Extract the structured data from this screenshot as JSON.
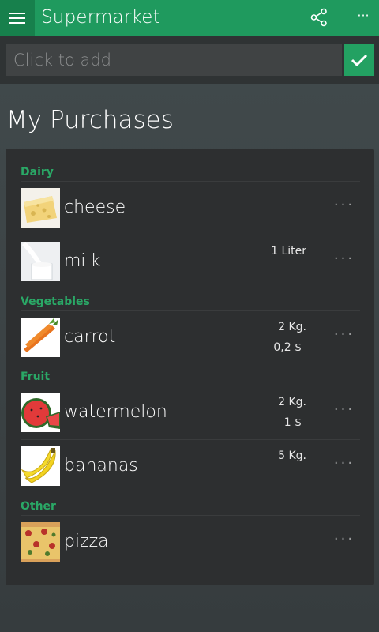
{
  "appbar": {
    "title": "Supermarket",
    "menu_icon": "hamburger-menu-icon",
    "share_icon": "share-icon",
    "more_icon": "ellipsis-icon",
    "more_label": "···",
    "bg_color": "#1f9a5e"
  },
  "addbar": {
    "placeholder": "Click to add",
    "confirm_icon": "checkmark-icon",
    "confirm_color": "#23a162"
  },
  "page": {
    "title": "My Purchases"
  },
  "accent_color": "#2aa866",
  "groups": [
    {
      "name": "Dairy",
      "items": [
        {
          "name": "cheese",
          "quantity": "",
          "price": "",
          "image": "cheese-image"
        },
        {
          "name": "milk",
          "quantity": "1 Liter",
          "price": "",
          "image": "milk-image"
        }
      ]
    },
    {
      "name": "Vegetables",
      "items": [
        {
          "name": "carrot",
          "quantity": "2 Kg.",
          "price": "0,2 $",
          "image": "carrot-image"
        }
      ]
    },
    {
      "name": "Fruit",
      "items": [
        {
          "name": "watermelon",
          "quantity": "2 Kg.",
          "price": "1 $",
          "image": "watermelon-image"
        },
        {
          "name": "bananas",
          "quantity": "5 Kg.",
          "price": "",
          "image": "bananas-image"
        }
      ]
    },
    {
      "name": "Other",
      "items": [
        {
          "name": "pizza",
          "quantity": "",
          "price": "",
          "image": "pizza-image"
        }
      ]
    }
  ],
  "item_more_label": "···"
}
